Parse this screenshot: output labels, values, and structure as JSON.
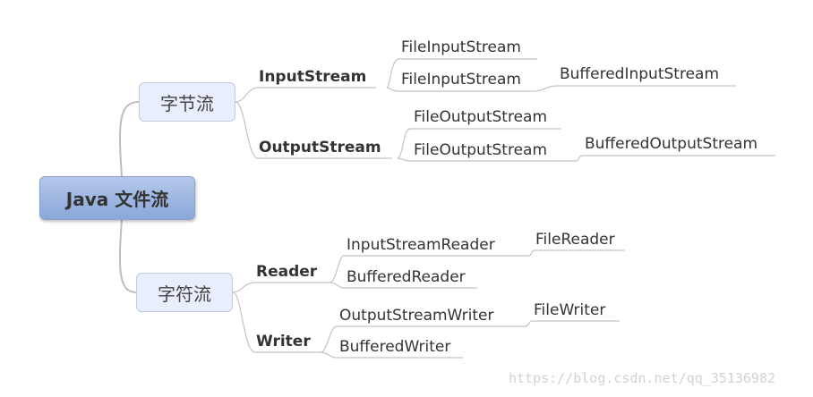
{
  "root": {
    "label": "Java 文件流"
  },
  "byte_stream": {
    "label": "字节流",
    "input": {
      "label": "InputStream",
      "file": "FileInputStream",
      "file2": "FileInputStream",
      "buffered": "BufferedInputStream"
    },
    "output": {
      "label": "OutputStream",
      "file": "FileOutputStream",
      "file2": "FileOutputStream",
      "buffered": "BufferedOutputStream"
    }
  },
  "char_stream": {
    "label": "字符流",
    "reader": {
      "label": "Reader",
      "isr": "InputStreamReader",
      "file_reader": "FileReader",
      "buffered": "BufferedReader"
    },
    "writer": {
      "label": "Writer",
      "osw": "OutputStreamWriter",
      "file_writer": "FileWriter",
      "buffered": "BufferedWriter"
    }
  },
  "watermark": "https://blog.csdn.net/qq_35136982",
  "colors": {
    "root_fill": "#9db6e2",
    "branch_fill": "#e8eefb",
    "line": "#b9b9b9"
  }
}
